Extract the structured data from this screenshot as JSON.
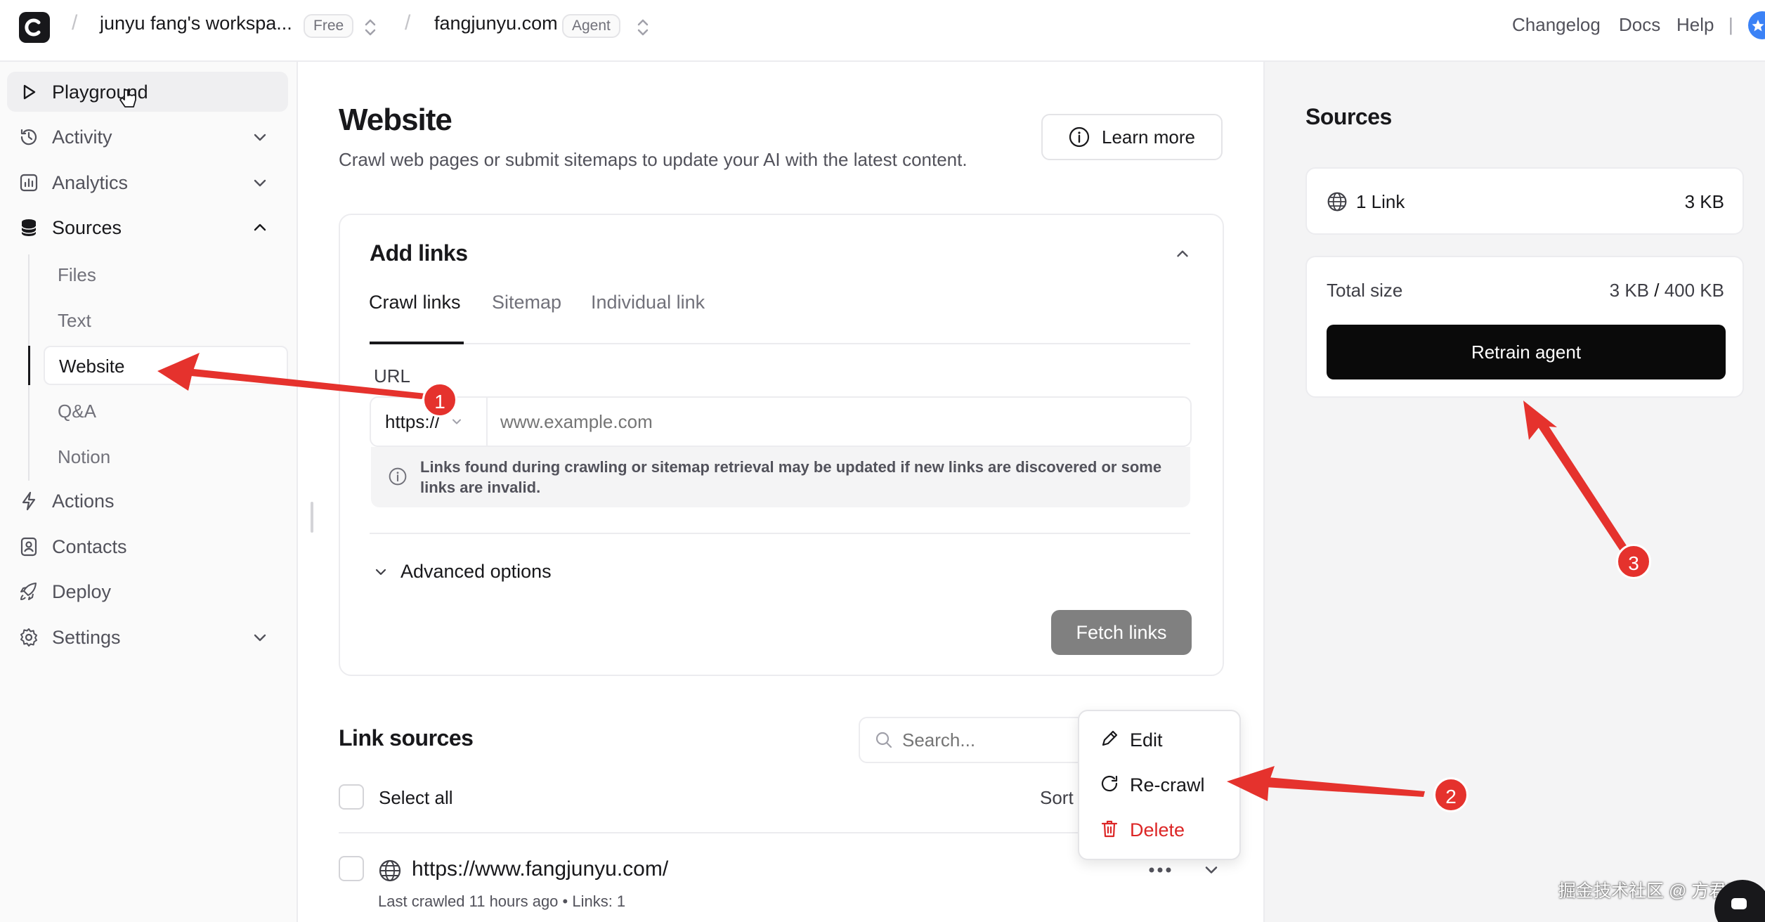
{
  "topbar": {
    "workspace_name": "junyu fang's workspa...",
    "workspace_badge": "Free",
    "agent_name": "fangjunyu.com",
    "agent_badge": "Agent",
    "links": [
      "Changelog",
      "Docs",
      "Help"
    ],
    "divider": "|"
  },
  "sidebar": {
    "items": [
      {
        "label": "Playground",
        "icon": "play-icon"
      },
      {
        "label": "Activity",
        "icon": "history-icon"
      },
      {
        "label": "Analytics",
        "icon": "bar-chart-icon"
      },
      {
        "label": "Sources",
        "icon": "database-icon"
      },
      {
        "label": "Actions",
        "icon": "bolt-icon"
      },
      {
        "label": "Contacts",
        "icon": "contact-icon"
      },
      {
        "label": "Deploy",
        "icon": "rocket-icon"
      },
      {
        "label": "Settings",
        "icon": "gear-icon"
      }
    ],
    "sources_sub": [
      "Files",
      "Text",
      "Website",
      "Q&A",
      "Notion"
    ],
    "active_sub": "Website"
  },
  "main": {
    "title": "Website",
    "subtitle": "Crawl web pages or submit sitemaps to update your AI with the latest content.",
    "learn_more": "Learn more",
    "add_links": {
      "title": "Add links",
      "tabs": [
        "Crawl links",
        "Sitemap",
        "Individual link"
      ],
      "active_tab": "Crawl links",
      "url_label": "URL",
      "protocol": "https://",
      "url_placeholder": "www.example.com",
      "note": "Links found during crawling or sitemap retrieval may be updated if new links are discovered or some links are invalid.",
      "advanced_options": "Advanced options",
      "fetch_button": "Fetch links"
    },
    "link_sources": {
      "title": "Link sources",
      "search_placeholder": "Search...",
      "select_all": "Select all",
      "sort_label": "Sort b",
      "rows": [
        {
          "url": "https://www.fangjunyu.com/",
          "meta": "Last crawled 11 hours ago • Links: 1"
        }
      ]
    }
  },
  "context_menu": {
    "items": [
      {
        "label": "Edit",
        "icon": "pencil-icon"
      },
      {
        "label": "Re-crawl",
        "icon": "refresh-icon"
      },
      {
        "label": "Delete",
        "icon": "trash-icon",
        "color": "#dc2626"
      }
    ]
  },
  "right_panel": {
    "title": "Sources",
    "link_count": "1 Link",
    "link_size": "3 KB",
    "total_size_label": "Total size",
    "total_size_used": "3 KB",
    "total_size_sep": " / ",
    "total_size_limit": "400 KB",
    "retrain_button": "Retrain agent"
  },
  "annotations": [
    "1",
    "2",
    "3"
  ],
  "watermark": "掘金技术社区 @ 方君宇",
  "colors": {
    "accent_dark": "#0a0a0a",
    "annotation_red": "#e5322d",
    "delete_red": "#dc2626",
    "disabled_button": "#808080"
  }
}
